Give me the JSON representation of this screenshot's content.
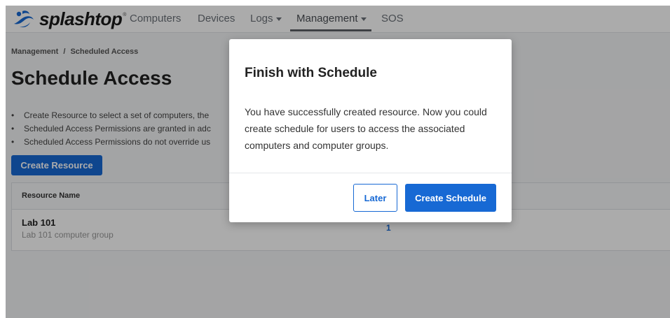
{
  "brand": {
    "name": "splashtop",
    "trademark": "®",
    "accent": "#1769d4"
  },
  "nav": {
    "items": [
      {
        "label": "Computers"
      },
      {
        "label": "Devices"
      },
      {
        "label": "Logs"
      },
      {
        "label": "Management"
      },
      {
        "label": "SOS"
      }
    ],
    "active": "Management"
  },
  "breadcrumb": {
    "parent": "Management",
    "separator": "/",
    "current": "Scheduled Access"
  },
  "page": {
    "title": "Schedule Access",
    "bullets": [
      "Create Resource to select a set of computers, the",
      "Scheduled Access Permissions are granted in adc",
      "Scheduled Access Permissions do not override us"
    ],
    "create_resource_label": "Create Resource"
  },
  "table": {
    "columns": [
      "Resource Name"
    ],
    "rows": [
      {
        "name": "Lab 101",
        "description": "Lab 101 computer group",
        "count": "1"
      }
    ]
  },
  "modal": {
    "title": "Finish with Schedule",
    "body": "You have successfully created resource. Now you could create schedule for users to access the associated computers and computer groups.",
    "later_label": "Later",
    "create_schedule_label": "Create Schedule"
  }
}
